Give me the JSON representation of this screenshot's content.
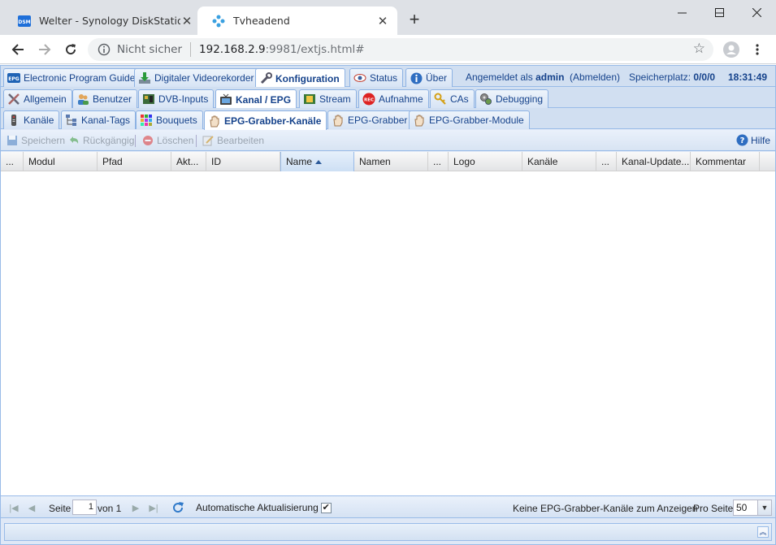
{
  "browser": {
    "tabs": [
      {
        "title": "Welter - Synology DiskStation",
        "icon": "dsm-icon"
      },
      {
        "title": "Tvheadend",
        "icon": "tvheadend-icon"
      }
    ],
    "security_label": "Nicht sicher",
    "url_host": "192.168.2.9",
    "url_rest": ":9981/extjs.html#"
  },
  "main_tabs": [
    {
      "label": "Electronic Program Guide"
    },
    {
      "label": "Digitaler Videorekorder"
    },
    {
      "label": "Konfiguration"
    },
    {
      "label": "Status"
    },
    {
      "label": "Über"
    }
  ],
  "header_info": {
    "logged_in_prefix": "Angemeldet als",
    "user": "admin",
    "logout": "(Abmelden)",
    "storage_prefix": "Speicherplatz:",
    "storage_value": "0/0/0",
    "time": "18:31:49"
  },
  "config_tabs": [
    {
      "label": "Allgemein"
    },
    {
      "label": "Benutzer"
    },
    {
      "label": "DVB-Inputs"
    },
    {
      "label": "Kanal / EPG"
    },
    {
      "label": "Stream"
    },
    {
      "label": "Aufnahme"
    },
    {
      "label": "CAs"
    },
    {
      "label": "Debugging"
    }
  ],
  "channel_tabs": [
    {
      "label": "Kanäle"
    },
    {
      "label": "Kanal-Tags"
    },
    {
      "label": "Bouquets"
    },
    {
      "label": "EPG-Grabber-Kanäle"
    },
    {
      "label": "EPG-Grabber"
    },
    {
      "label": "EPG-Grabber-Module"
    }
  ],
  "toolbar": {
    "save": "Speichern",
    "undo": "Rückgängig",
    "delete": "Löschen",
    "edit": "Bearbeiten",
    "help": "Hilfe"
  },
  "columns": [
    {
      "label": "..."
    },
    {
      "label": "Modul"
    },
    {
      "label": "Pfad"
    },
    {
      "label": "Akt..."
    },
    {
      "label": "ID"
    },
    {
      "label": "Name",
      "sorted": "asc"
    },
    {
      "label": "Namen"
    },
    {
      "label": "..."
    },
    {
      "label": "Logo"
    },
    {
      "label": "Kanäle"
    },
    {
      "label": "..."
    },
    {
      "label": "Kanal-Update..."
    },
    {
      "label": "Kommentar"
    }
  ],
  "rows": [],
  "pager": {
    "page_label": "Seite",
    "page_value": "1",
    "of_label": "von 1",
    "auto_refresh_label": "Automatische Aktualisierung",
    "auto_refresh_checked": true,
    "empty_msg": "Keine EPG-Grabber-Kanäle zum Anzeigen",
    "per_page_label": "Pro Seite",
    "per_page_value": "50"
  },
  "colors": {
    "accent": "#15428b",
    "border": "#99bbe8",
    "panel_bg": "#dfe8f6"
  }
}
